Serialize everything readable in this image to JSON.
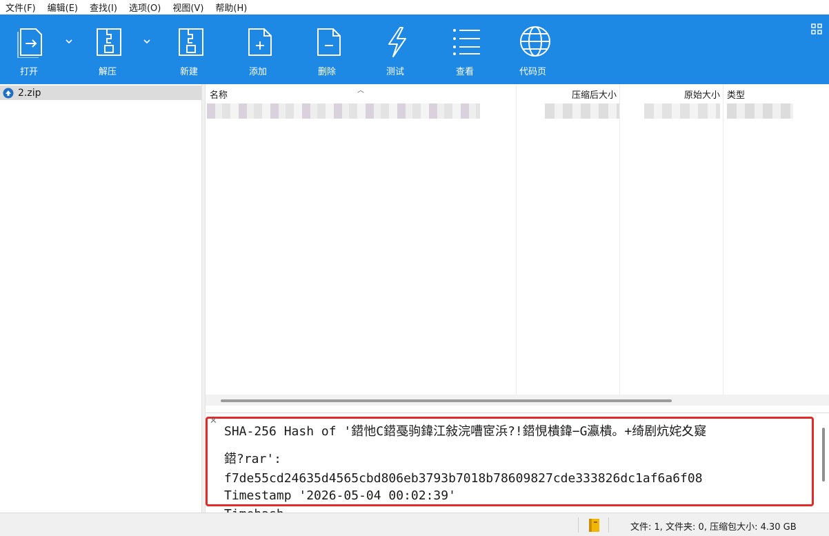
{
  "menubar": {
    "items": [
      "文件(F)",
      "编辑(E)",
      "查找(I)",
      "选项(O)",
      "视图(V)",
      "帮助(H)"
    ]
  },
  "toolbar": {
    "open_label": "打开",
    "extract_label": "解压",
    "new_label": "新建",
    "add_label": "添加",
    "delete_label": "删除",
    "test_label": "测试",
    "view_label": "查看",
    "codepage_label": "代码页"
  },
  "tree": {
    "archive_name": "2.zip"
  },
  "filelist": {
    "columns": {
      "name": "名称",
      "compressed_size": "压缩后大小",
      "original_size": "原始大小",
      "type": "类型"
    }
  },
  "infopane": {
    "line1": "SHA-256 Hash of '鍣忚C鍣戞驹鍏江敍浣嘈宧浜?!鍣悓樻鍏−G瀛樻。+绮剧炕姹夊寲",
    "line2": "鍣?rar':",
    "hash_value": "f7de55cd24635d4565cbd806eb3793b7018b78609827cde333826dc1af6a6f08",
    "timestamp_line": "Timestamp '2026-05-04 00:02:39'",
    "cut_line": "Timehash"
  },
  "statusbar": {
    "summary": "文件: 1, 文件夹: 0, 压缩包大小: 4.30 GB"
  },
  "colors": {
    "toolbar_bg": "#1e88e5",
    "highlight_border": "#e02b2b"
  }
}
